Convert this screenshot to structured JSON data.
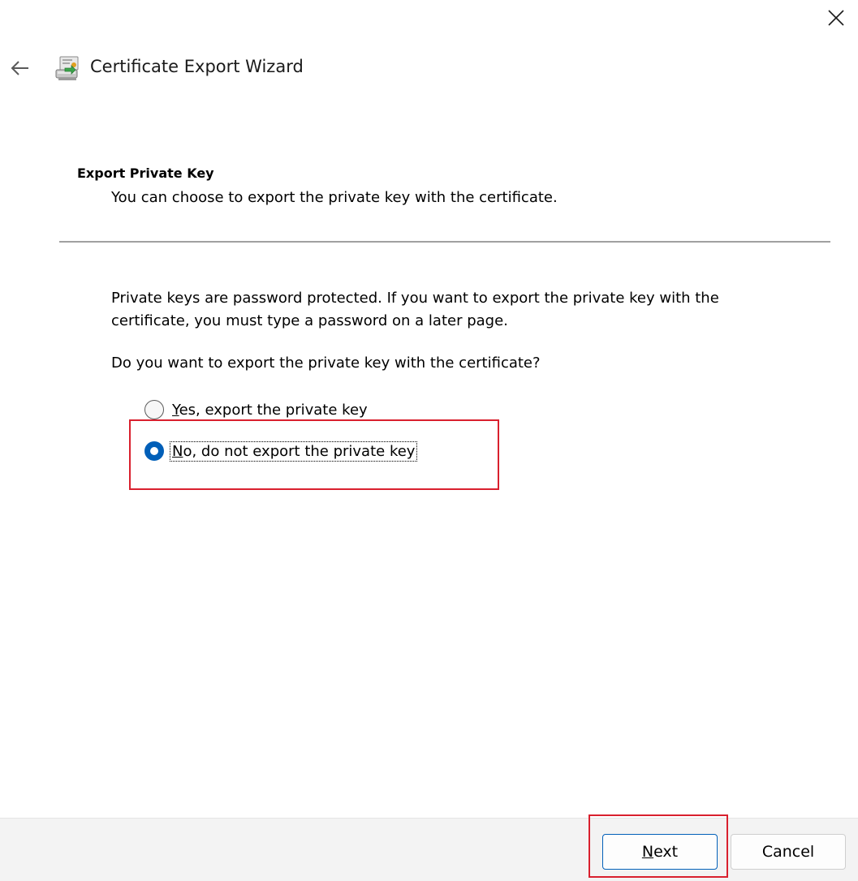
{
  "window": {
    "title": "Certificate Export Wizard",
    "close_icon": "close-icon",
    "back_icon": "back-arrow-icon",
    "app_icon": "certificate-wizard-icon"
  },
  "section": {
    "header": "Export Private Key",
    "subtitle": "You can choose to export the private key with the certificate."
  },
  "body": {
    "para1_line1": "Private keys are password protected. If you want to export the private key with the",
    "para1_line2": "certificate, you must type a password on a later page.",
    "question": "Do you want to export the private key with the certificate?"
  },
  "options": {
    "yes": {
      "mnemonic": "Y",
      "rest": "es, export the private key",
      "selected": false
    },
    "no": {
      "mnemonic": "N",
      "rest": "o, do not export the private key",
      "selected": true
    }
  },
  "buttons": {
    "next": {
      "mnemonic": "N",
      "rest": "ext"
    },
    "cancel": "Cancel"
  },
  "colors": {
    "accent": "#005fb8",
    "highlight": "#d9202e",
    "footer_bg": "#f3f3f3"
  }
}
